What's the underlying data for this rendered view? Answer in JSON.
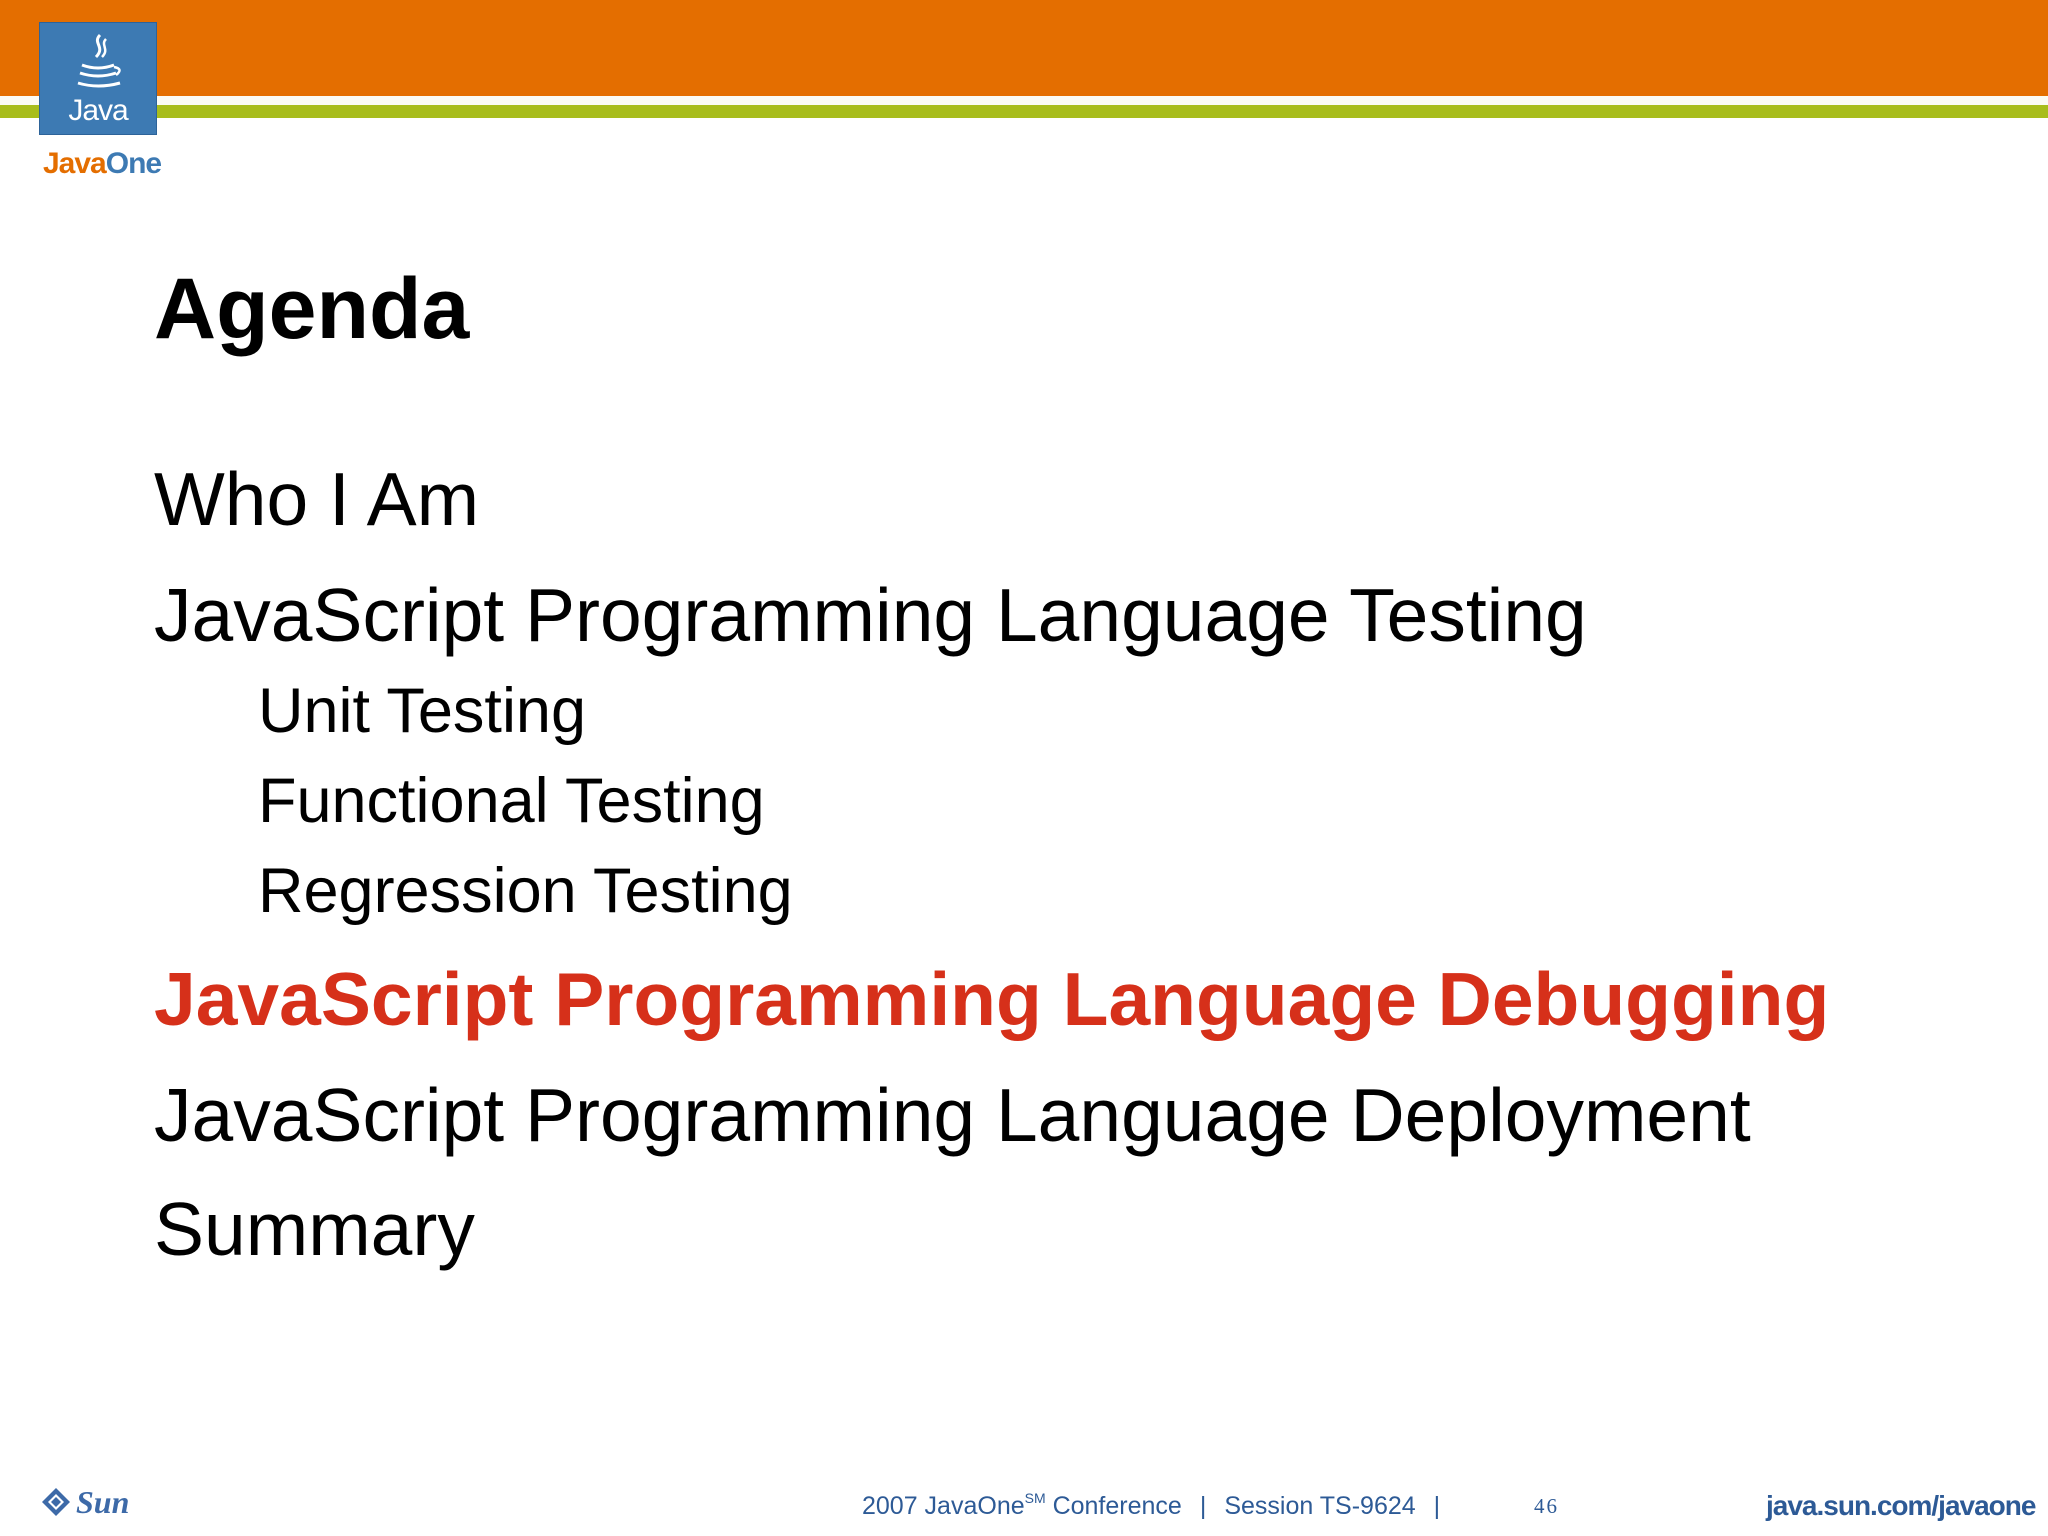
{
  "header": {
    "logo_text": "Java",
    "brand_java": "Java",
    "brand_one": "One",
    "colors": {
      "orange": "#e46e00",
      "green": "#a8bd1c",
      "blue": "#3d7ab3"
    }
  },
  "slide": {
    "title": "Agenda",
    "items": [
      {
        "text": "Who I Am",
        "level": 1,
        "current": false
      },
      {
        "text": "JavaScript Programming Language Testing",
        "level": 1,
        "current": false
      },
      {
        "text": "Unit Testing",
        "level": 2,
        "current": false
      },
      {
        "text": "Functional Testing",
        "level": 2,
        "current": false
      },
      {
        "text": "Regression Testing",
        "level": 2,
        "current": false
      },
      {
        "text": "JavaScript Programming Language Debugging",
        "level": 1,
        "current": true
      },
      {
        "text": "JavaScript Programming Language Deployment",
        "level": 1,
        "current": false
      },
      {
        "text": "Summary",
        "level": 1,
        "current": false
      }
    ],
    "highlight_color": "#d6301a"
  },
  "footer": {
    "sun_logo_text": "Sun",
    "conference_pre": "2007 JavaOne",
    "conference_sup": "SM",
    "conference_post": " Conference",
    "separator": "|",
    "session": "Session TS-9624",
    "page_number": "46",
    "website": "java.sun.com/javaone"
  }
}
